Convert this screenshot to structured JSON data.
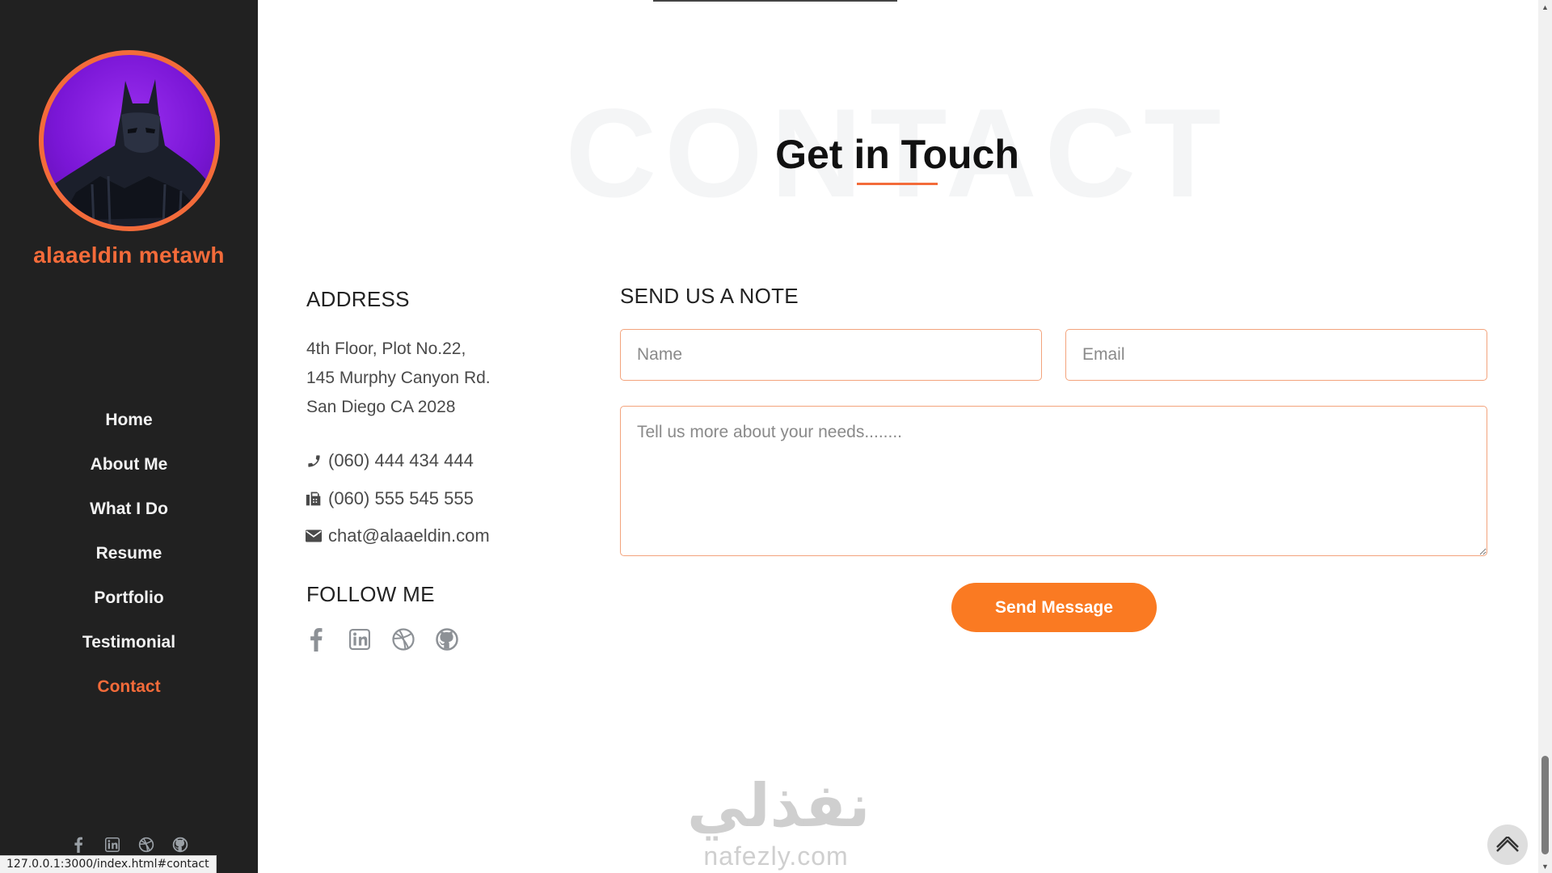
{
  "sidebar": {
    "owner_name": "alaaeldin metawh",
    "nav": [
      {
        "label": "Home",
        "active": false
      },
      {
        "label": "About Me",
        "active": false
      },
      {
        "label": "What I Do",
        "active": false
      },
      {
        "label": "Resume",
        "active": false
      },
      {
        "label": "Portfolio",
        "active": false
      },
      {
        "label": "Testimonial",
        "active": false
      },
      {
        "label": "Contact",
        "active": true
      }
    ],
    "social_icons": [
      "facebook-icon",
      "linkedin-icon",
      "dribbble-icon",
      "github-icon"
    ]
  },
  "status_bar": {
    "url": "127.0.0.1:3000/index.html#contact"
  },
  "section": {
    "bg_word": "CONTACT",
    "title": "Get in Touch"
  },
  "address": {
    "heading": "ADDRESS",
    "lines": [
      "4th Floor, Plot No.22,",
      "145 Murphy Canyon Rd.",
      "San Diego CA 2028"
    ],
    "phone": "(060) 444 434 444",
    "fax": "(060) 555 545 555",
    "email": "chat@alaaeldin.com"
  },
  "follow": {
    "heading": "FOLLOW ME",
    "icons": [
      "facebook-icon",
      "linkedin-icon",
      "dribbble-icon",
      "github-icon"
    ]
  },
  "form": {
    "heading": "SEND US A NOTE",
    "name_placeholder": "Name",
    "email_placeholder": "Email",
    "message_placeholder": "Tell us more about your needs........",
    "send_label": "Send Message"
  },
  "watermark": {
    "arabic": "نفذلي",
    "latin": "nafezly.com"
  },
  "colors": {
    "accent": "#f36b3a",
    "button": "#fa7a22",
    "sidebar_bg": "#212121"
  }
}
